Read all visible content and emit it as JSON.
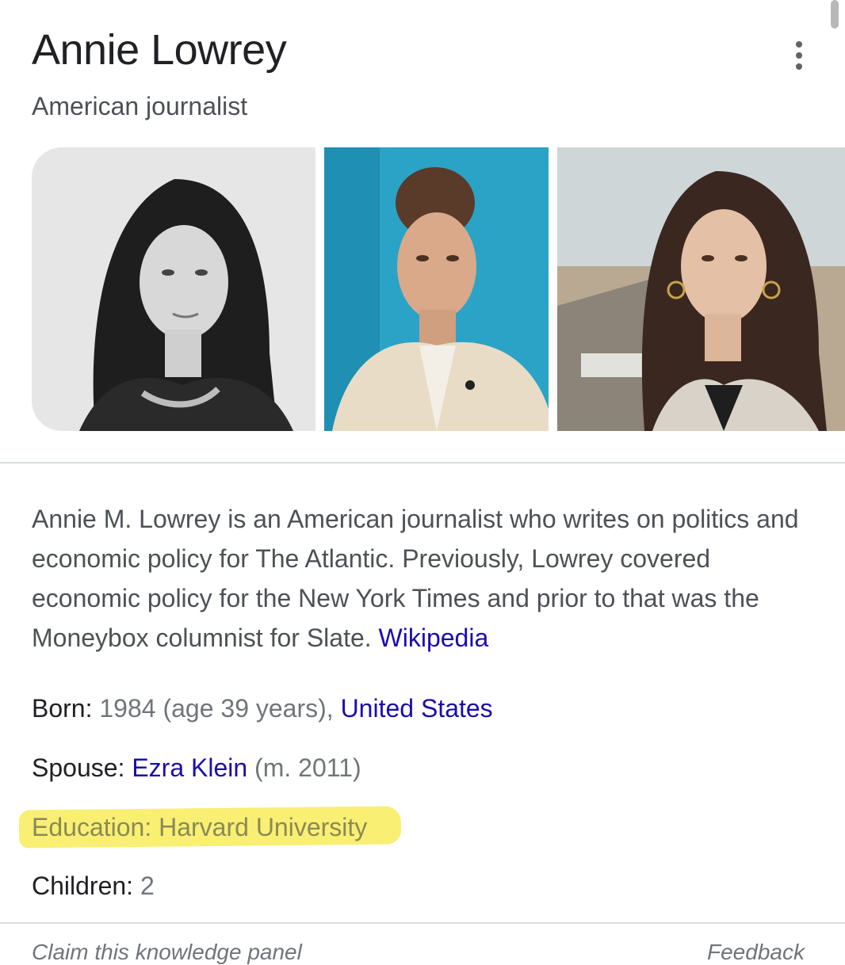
{
  "header": {
    "title": "Annie Lowrey",
    "subtitle": "American journalist"
  },
  "description": {
    "text": "Annie M. Lowrey is an American journalist who writes on politics and economic policy for The Atlantic. Previously, Lowrey covered economic policy for the New York Times and prior to that was the Moneybox columnist for Slate.",
    "source_link": "Wikipedia"
  },
  "facts": {
    "born": {
      "label": "Born:",
      "value": "1984 (age 39 years),",
      "link": "United States"
    },
    "spouse": {
      "label": "Spouse:",
      "link": "Ezra Klein",
      "suffix": "(m. 2011)"
    },
    "education": {
      "label": "Education:",
      "link": "Harvard University",
      "highlight_color": "#f8ec5a"
    },
    "children": {
      "label": "Children:",
      "value": "2"
    }
  },
  "footer": {
    "claim": "Claim this knowledge panel",
    "feedback": "Feedback"
  },
  "icons": {
    "more": "more-vert-icon"
  },
  "colors": {
    "link": "#1a0dab",
    "highlight": "#f8ec5a"
  }
}
